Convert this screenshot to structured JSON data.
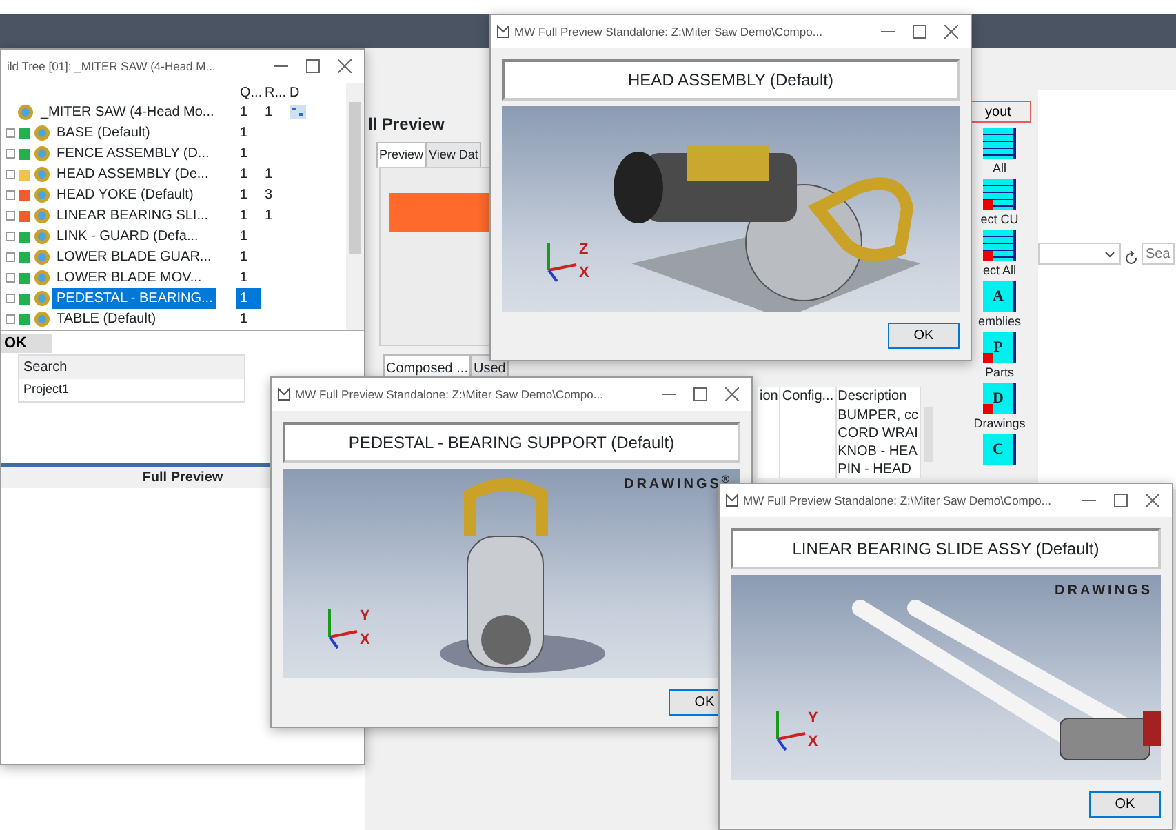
{
  "app_window": {
    "panel_title": "ll Preview",
    "tabs": [
      {
        "label": "Preview",
        "selected": true
      },
      {
        "label": "View Dat",
        "selected": false
      }
    ],
    "bottom_tabs": [
      {
        "label": "Composed ...",
        "selected": true
      },
      {
        "label": "Used",
        "selected": false
      }
    ],
    "grid": {
      "columns": [
        "ion",
        "Config...",
        "Description"
      ],
      "rows": [
        "BUMPER, cc",
        "CORD WRAI",
        "KNOB - HEA",
        "PIN - HEAD"
      ]
    },
    "layout_button": "yout",
    "toolbar": [
      {
        "label": "All",
        "marker": false
      },
      {
        "label": "ect CU",
        "marker": true
      },
      {
        "label": "ect All",
        "marker": true
      },
      {
        "label": "emblies",
        "letter": "A",
        "marker": false
      },
      {
        "label": "Parts",
        "letter": "P",
        "marker": true
      },
      {
        "label": "Drawings",
        "letter": "D",
        "marker": true
      },
      {
        "letter": "C",
        "marker": false
      }
    ],
    "search": {
      "placeholder": "Sea"
    }
  },
  "tree_window": {
    "title": "ild Tree [01]: _MITER SAW (4-Head M...",
    "columns": [
      "Q...",
      "R...",
      "D"
    ],
    "tree": [
      {
        "label": "_MITER SAW (4-Head Mo...",
        "q": "1",
        "r": "1",
        "selected": false,
        "children": [
          {
            "label": "BASE (Default)",
            "color": "#22b14c",
            "q": "1",
            "selected": false
          },
          {
            "label": "FENCE ASSEMBLY (D...",
            "color": "#22b14c",
            "q": "1",
            "selected": false
          },
          {
            "label": "HEAD ASSEMBLY (De...",
            "color": "#f2c14e",
            "q": "1",
            "r": "1",
            "selected": false
          },
          {
            "label": "HEAD YOKE (Default)",
            "color": "#f25c2e",
            "q": "1",
            "r": "3",
            "selected": false
          },
          {
            "label": "LINEAR BEARING SLI...",
            "color": "#f25c2e",
            "q": "1",
            "r": "1",
            "selected": false
          },
          {
            "label": "LINK - GUARD (Defa...",
            "color": "#22b14c",
            "q": "1",
            "selected": false
          },
          {
            "label": "LOWER BLADE GUAR...",
            "color": "#22b14c",
            "q": "1",
            "selected": false
          },
          {
            "label": "LOWER BLADE MOV...",
            "color": "#22b14c",
            "q": "1",
            "selected": false
          },
          {
            "label": "PEDESTAL - BEARING...",
            "color": "#22b14c",
            "q": "1",
            "selected": true
          },
          {
            "label": "TABLE (Default)",
            "color": "#22b14c",
            "q": "1",
            "selected": false
          }
        ]
      }
    ],
    "ok_label": "OK",
    "search_table": {
      "header": "Search",
      "rows": [
        "Project1"
      ]
    },
    "footer": "Full Preview"
  },
  "preview_windows": [
    {
      "title": "MW Full Preview Standalone: Z:\\Miter Saw Demo\\Compo...",
      "heading": "HEAD ASSEMBLY (Default)",
      "kind": "saw",
      "axes": [
        "Z",
        "X"
      ],
      "ok": "OK"
    },
    {
      "title": "MW Full Preview Standalone: Z:\\Miter Saw Demo\\Compo...",
      "heading": "PEDESTAL - BEARING SUPPORT (Default)",
      "kind": "pedestal",
      "logo": "DRAWINGS$^{®}$",
      "axes": [
        "Y",
        "X"
      ],
      "ok": "OK"
    },
    {
      "title": "MW Full Preview Standalone: Z:\\Miter Saw Demo\\Compo...",
      "heading": "LINEAR BEARING SLIDE ASSY (Default)",
      "kind": "slide",
      "logo": "DRAWINGS",
      "axes": [
        "Y",
        "X"
      ],
      "ok": "OK"
    }
  ]
}
